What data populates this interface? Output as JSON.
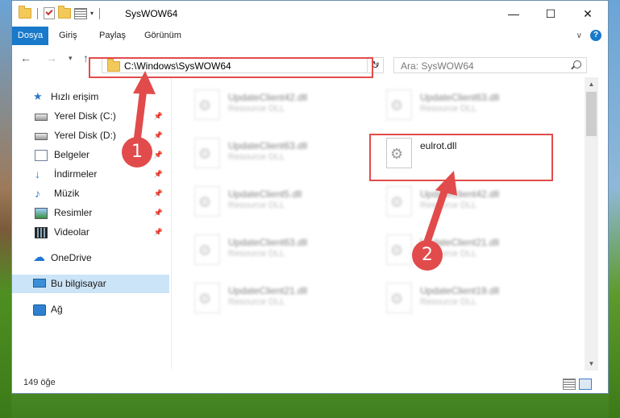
{
  "window": {
    "title": "SysWOW64",
    "controls": [
      "minimize-icon",
      "maximize-icon",
      "close-icon"
    ]
  },
  "ribbon": {
    "tabs": [
      "Dosya",
      "Giriş",
      "Paylaş",
      "Görünüm"
    ]
  },
  "address": {
    "path": "C:\\Windows\\SysWOW64",
    "search_placeholder": "Ara: SysWOW64"
  },
  "sidebar": {
    "quick_access": "Hızlı erişim",
    "items": [
      {
        "label": "Yerel Disk (C:)",
        "icon": "drive-icon"
      },
      {
        "label": "Yerel Disk (D:)",
        "icon": "drive-icon"
      },
      {
        "label": "Belgeler",
        "icon": "documents-icon"
      },
      {
        "label": "İndirmeler",
        "icon": "download-icon"
      },
      {
        "label": "Müzik",
        "icon": "music-icon"
      },
      {
        "label": "Resimler",
        "icon": "pictures-icon"
      },
      {
        "label": "Videolar",
        "icon": "videos-icon"
      }
    ],
    "onedrive": "OneDrive",
    "this_pc": "Bu bilgisayar",
    "network": "Ağ"
  },
  "files": [
    {
      "name": "UpdateClient42.dll",
      "type": "Resource DLL"
    },
    {
      "name": "UpdateClient63.dll",
      "type": "Resource DLL"
    },
    {
      "name": "UpdateClient63.dll",
      "type": "Resource DLL"
    },
    {
      "name": "eulrot.dll",
      "type": ""
    },
    {
      "name": "UpdateClient5.dll",
      "type": "Resource DLL"
    },
    {
      "name": "UpdateClient42.dll",
      "type": "Resource DLL"
    },
    {
      "name": "UpdateClient63.dll",
      "type": "Resource DLL"
    },
    {
      "name": "UpdateClient21.dll",
      "type": "Resource DLL"
    },
    {
      "name": "UpdateClient21.dll",
      "type": "Resource DLL"
    },
    {
      "name": "UpdateClient19.dll",
      "type": "Resource DLL"
    }
  ],
  "status": {
    "item_count": "149 öğe"
  },
  "annotations": {
    "marker_1": "1",
    "marker_2": "2",
    "highlight_color": "#e24b4b"
  },
  "colors": {
    "accent": "#1979ca",
    "selection": "#cce4f7"
  }
}
